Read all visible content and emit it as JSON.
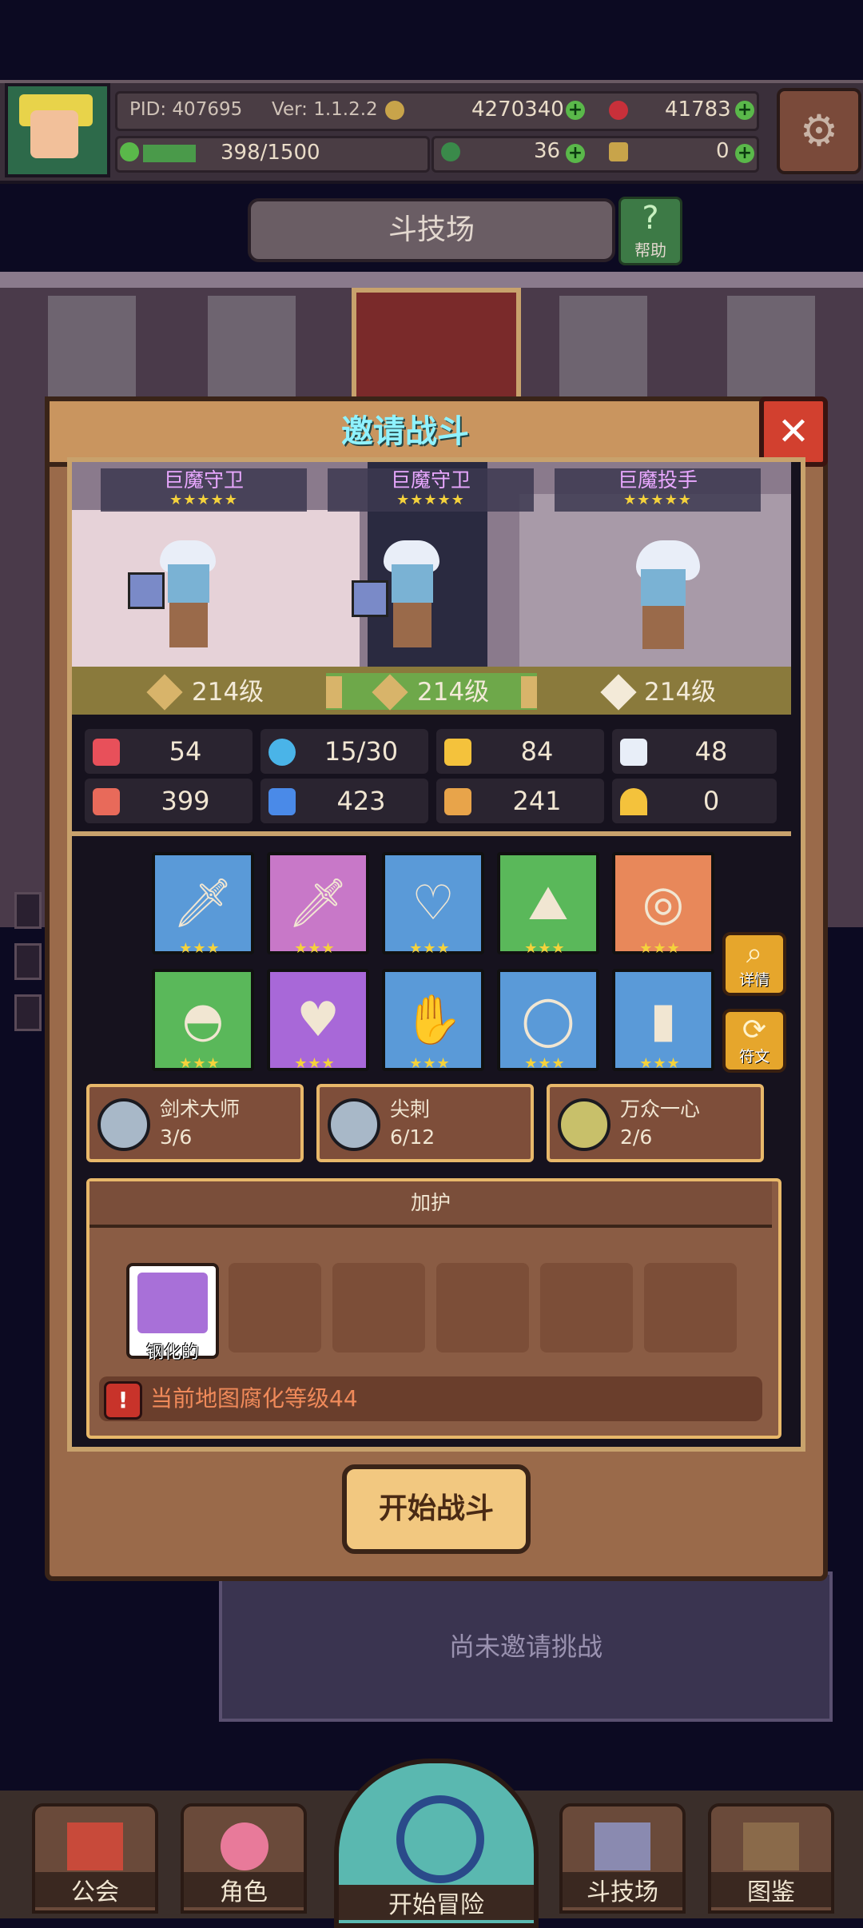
{
  "status": {
    "pid": "PID: 407695",
    "version": "Ver: 1.1.2.2",
    "gold": "4270340",
    "gems": "41783",
    "exp": "398/1500",
    "clover": "36",
    "key": "0"
  },
  "arena": {
    "title": "斗技场",
    "help": "帮助"
  },
  "dialog": {
    "title": "邀请战斗",
    "characters": [
      {
        "name": "巨魔守卫",
        "stars": "★★★★★",
        "level": "214级"
      },
      {
        "name": "巨魔守卫",
        "stars": "★★★★★",
        "level": "214级"
      },
      {
        "name": "巨魔投手",
        "stars": "★★★★★",
        "level": "214级"
      }
    ],
    "stats": [
      {
        "icon": "heart-icon",
        "value": "54",
        "color": "#e8505a"
      },
      {
        "icon": "water-drop-icon",
        "value": "15/30",
        "color": "#4ab4e8"
      },
      {
        "icon": "shield-icon",
        "value": "84",
        "color": "#f4c23c"
      },
      {
        "icon": "wing-icon",
        "value": "48",
        "color": "#e8eef8"
      },
      {
        "icon": "fist-icon",
        "value": "399",
        "color": "#e86a5a"
      },
      {
        "icon": "book-icon",
        "value": "423",
        "color": "#4a8ae8"
      },
      {
        "icon": "scroll-icon",
        "value": "241",
        "color": "#e8a44a"
      },
      {
        "icon": "horseshoe-icon",
        "value": "0",
        "color": "#f4c23c"
      }
    ],
    "items_row1": [
      {
        "icon": "sword-icon",
        "glyph": "🗡",
        "bg": "#5a9ad8",
        "stars": "★★★"
      },
      {
        "icon": "dagger-icon",
        "glyph": "🗡",
        "bg": "#c878c8",
        "stars": "★★★"
      },
      {
        "icon": "necklace-icon",
        "glyph": "♡",
        "bg": "#5a9ad8",
        "stars": "★★★"
      },
      {
        "icon": "hat-icon",
        "glyph": "⛰",
        "bg": "#5ab85a",
        "stars": "★★★"
      },
      {
        "icon": "ring-icon",
        "glyph": "◎",
        "bg": "#e8885a",
        "stars": "★★★"
      }
    ],
    "items_row2": [
      {
        "icon": "helmet-icon",
        "glyph": "◓",
        "bg": "#5ab85a",
        "stars": "★★★"
      },
      {
        "icon": "armor-icon",
        "glyph": "♥",
        "bg": "#a868d8",
        "stars": "★★★"
      },
      {
        "icon": "glove-icon",
        "glyph": "✋",
        "bg": "#5a9ad8",
        "stars": "★★★"
      },
      {
        "icon": "belt-icon",
        "glyph": "◯",
        "bg": "#5a9ad8",
        "stars": "★★★"
      },
      {
        "icon": "boots-icon",
        "glyph": "▮",
        "bg": "#5a9ad8",
        "stars": "★★★"
      }
    ],
    "details_label": "详情",
    "rune_label": "符文",
    "skills": [
      {
        "name": "剑术大师",
        "progress": "3/6"
      },
      {
        "name": "尖刺",
        "progress": "6/12"
      },
      {
        "name": "万众一心",
        "progress": "2/6"
      }
    ],
    "buff_title": "加护",
    "buff_item": "钢化的",
    "warning": "当前地图腐化等级44",
    "start_button": "开始战斗"
  },
  "lower_panel": "尚未邀请挑战",
  "nav": [
    "公会",
    "角色",
    "开始冒险",
    "斗技场",
    "图鉴"
  ]
}
